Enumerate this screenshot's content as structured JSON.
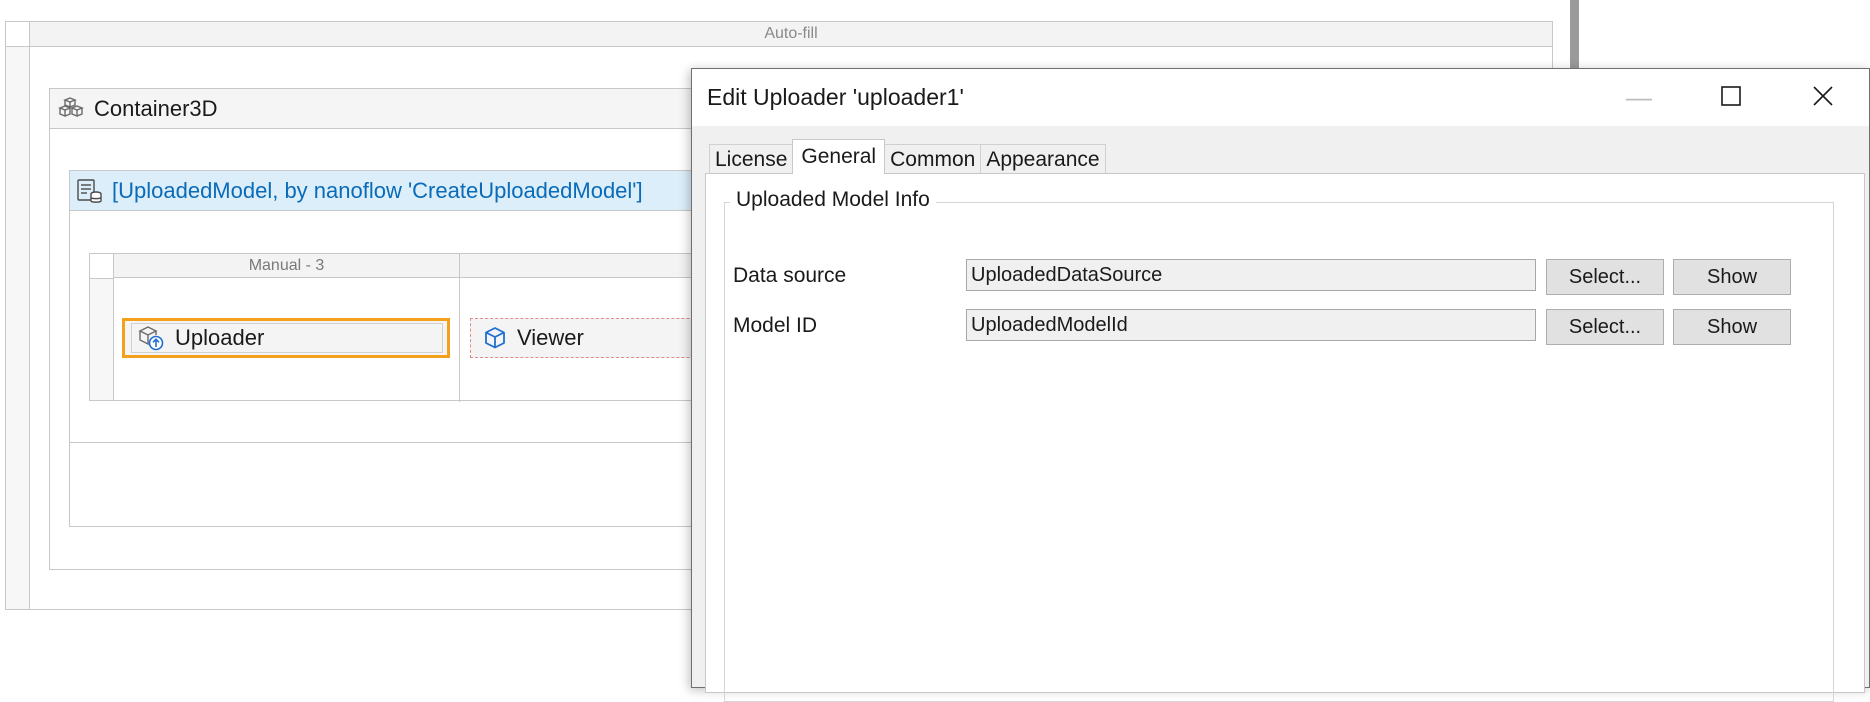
{
  "canvas": {
    "autofill_label": "Auto-fill",
    "container": {
      "label": "Container3D",
      "icon": "container-3d-icon"
    },
    "dataview": {
      "label": "[UploadedModel, by nanoflow 'CreateUploadedModel']",
      "icon": "dataview-icon"
    },
    "layout_grid": {
      "column1_title": "Manual - 3"
    },
    "widgets": {
      "uploader": {
        "label": "Uploader",
        "icon": "uploader-icon"
      },
      "viewer": {
        "label": "Viewer",
        "icon": "cube-icon"
      }
    }
  },
  "dialog": {
    "title": "Edit Uploader 'uploader1'",
    "window_controls": {
      "minimize": "—",
      "maximize": "☐",
      "close": "✕"
    },
    "tabs": [
      {
        "label": "License"
      },
      {
        "label": "General"
      },
      {
        "label": "Common"
      },
      {
        "label": "Appearance"
      }
    ],
    "active_tab": "General",
    "group": {
      "title": "Uploaded Model Info",
      "fields": [
        {
          "label": "Data source",
          "value": "UploadedDataSource",
          "select_label": "Select...",
          "show_label": "Show"
        },
        {
          "label": "Model ID",
          "value": "UploadedModelId",
          "select_label": "Select...",
          "show_label": "Show"
        }
      ]
    }
  },
  "colors": {
    "selection_accent": "#f3a11a",
    "dataview_header_bg": "#dceefa",
    "dataview_text": "#0a6bb8",
    "icon_blue": "#1f6fd1"
  }
}
